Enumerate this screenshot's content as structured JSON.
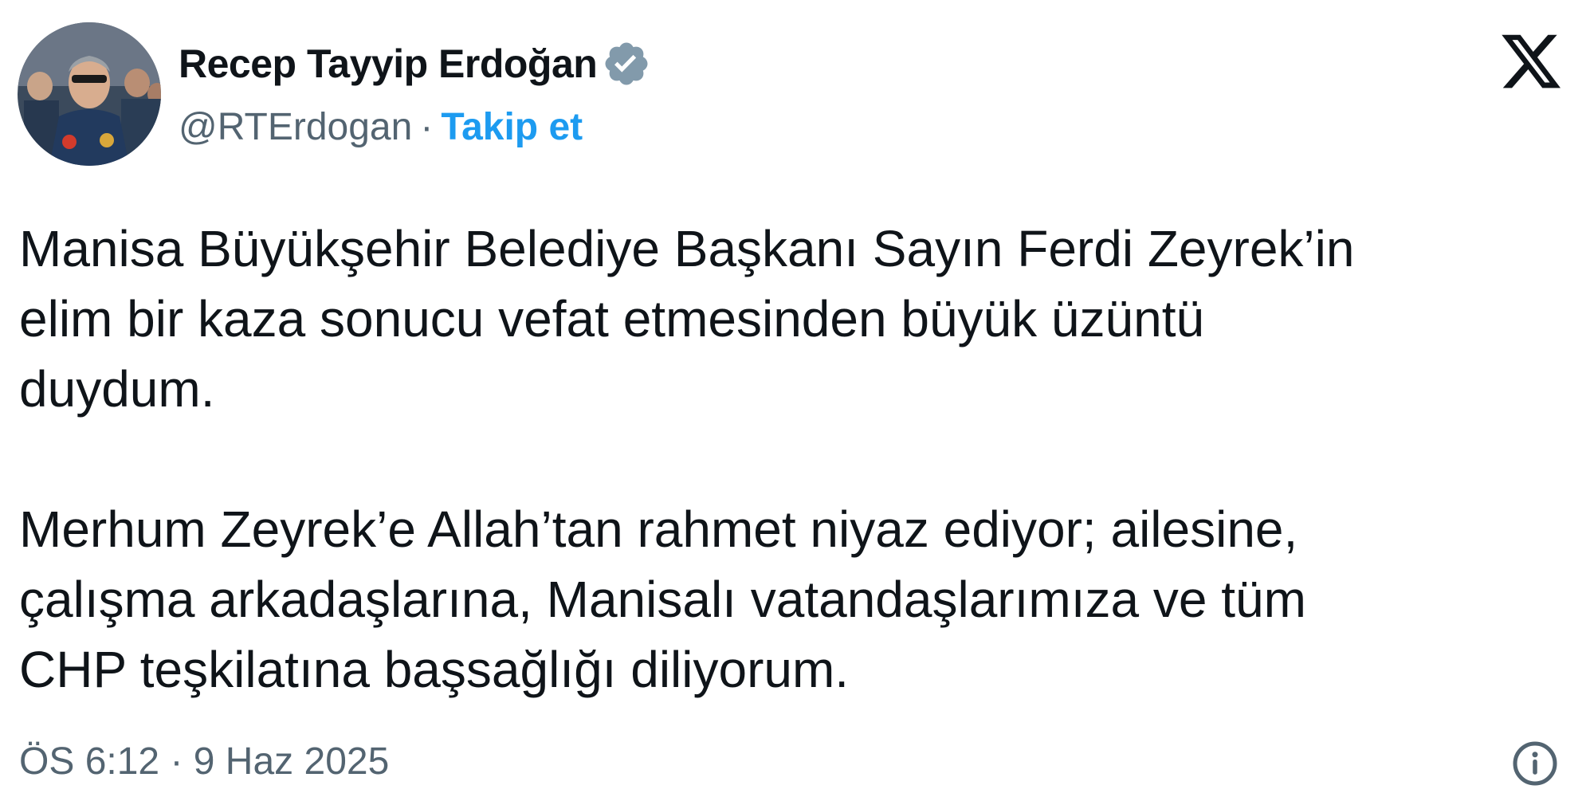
{
  "tweet": {
    "author_name": "Recep Tayyip Erdoğan",
    "handle": "@RTErdogan",
    "separator": "·",
    "follow_label": "Takip et",
    "paragraph_1": "Manisa Büyükşehir Belediye Başkanı Sayın Ferdi Zeyrek’in\nelim bir kaza sonucu vefat etmesinden büyük üzüntü\nduydum.",
    "paragraph_2": "Merhum Zeyrek’e Allah’tan rahmet niyaz ediyor; ailesine,\nçalışma arkadaşlarına, Manisalı vatandaşlarımıza ve tüm\nCHP teşkilatına başsağlığı diliyorum.",
    "timestamp": "ÖS 6:12 · 9 Haz 2025"
  },
  "icons": {
    "verified": "verified-badge-icon",
    "platform": "x-logo-icon",
    "info": "info-icon"
  },
  "colors": {
    "text": "#0f1419",
    "secondary": "#536471",
    "link": "#1d9bf0",
    "verified_badge": "#829aab"
  }
}
